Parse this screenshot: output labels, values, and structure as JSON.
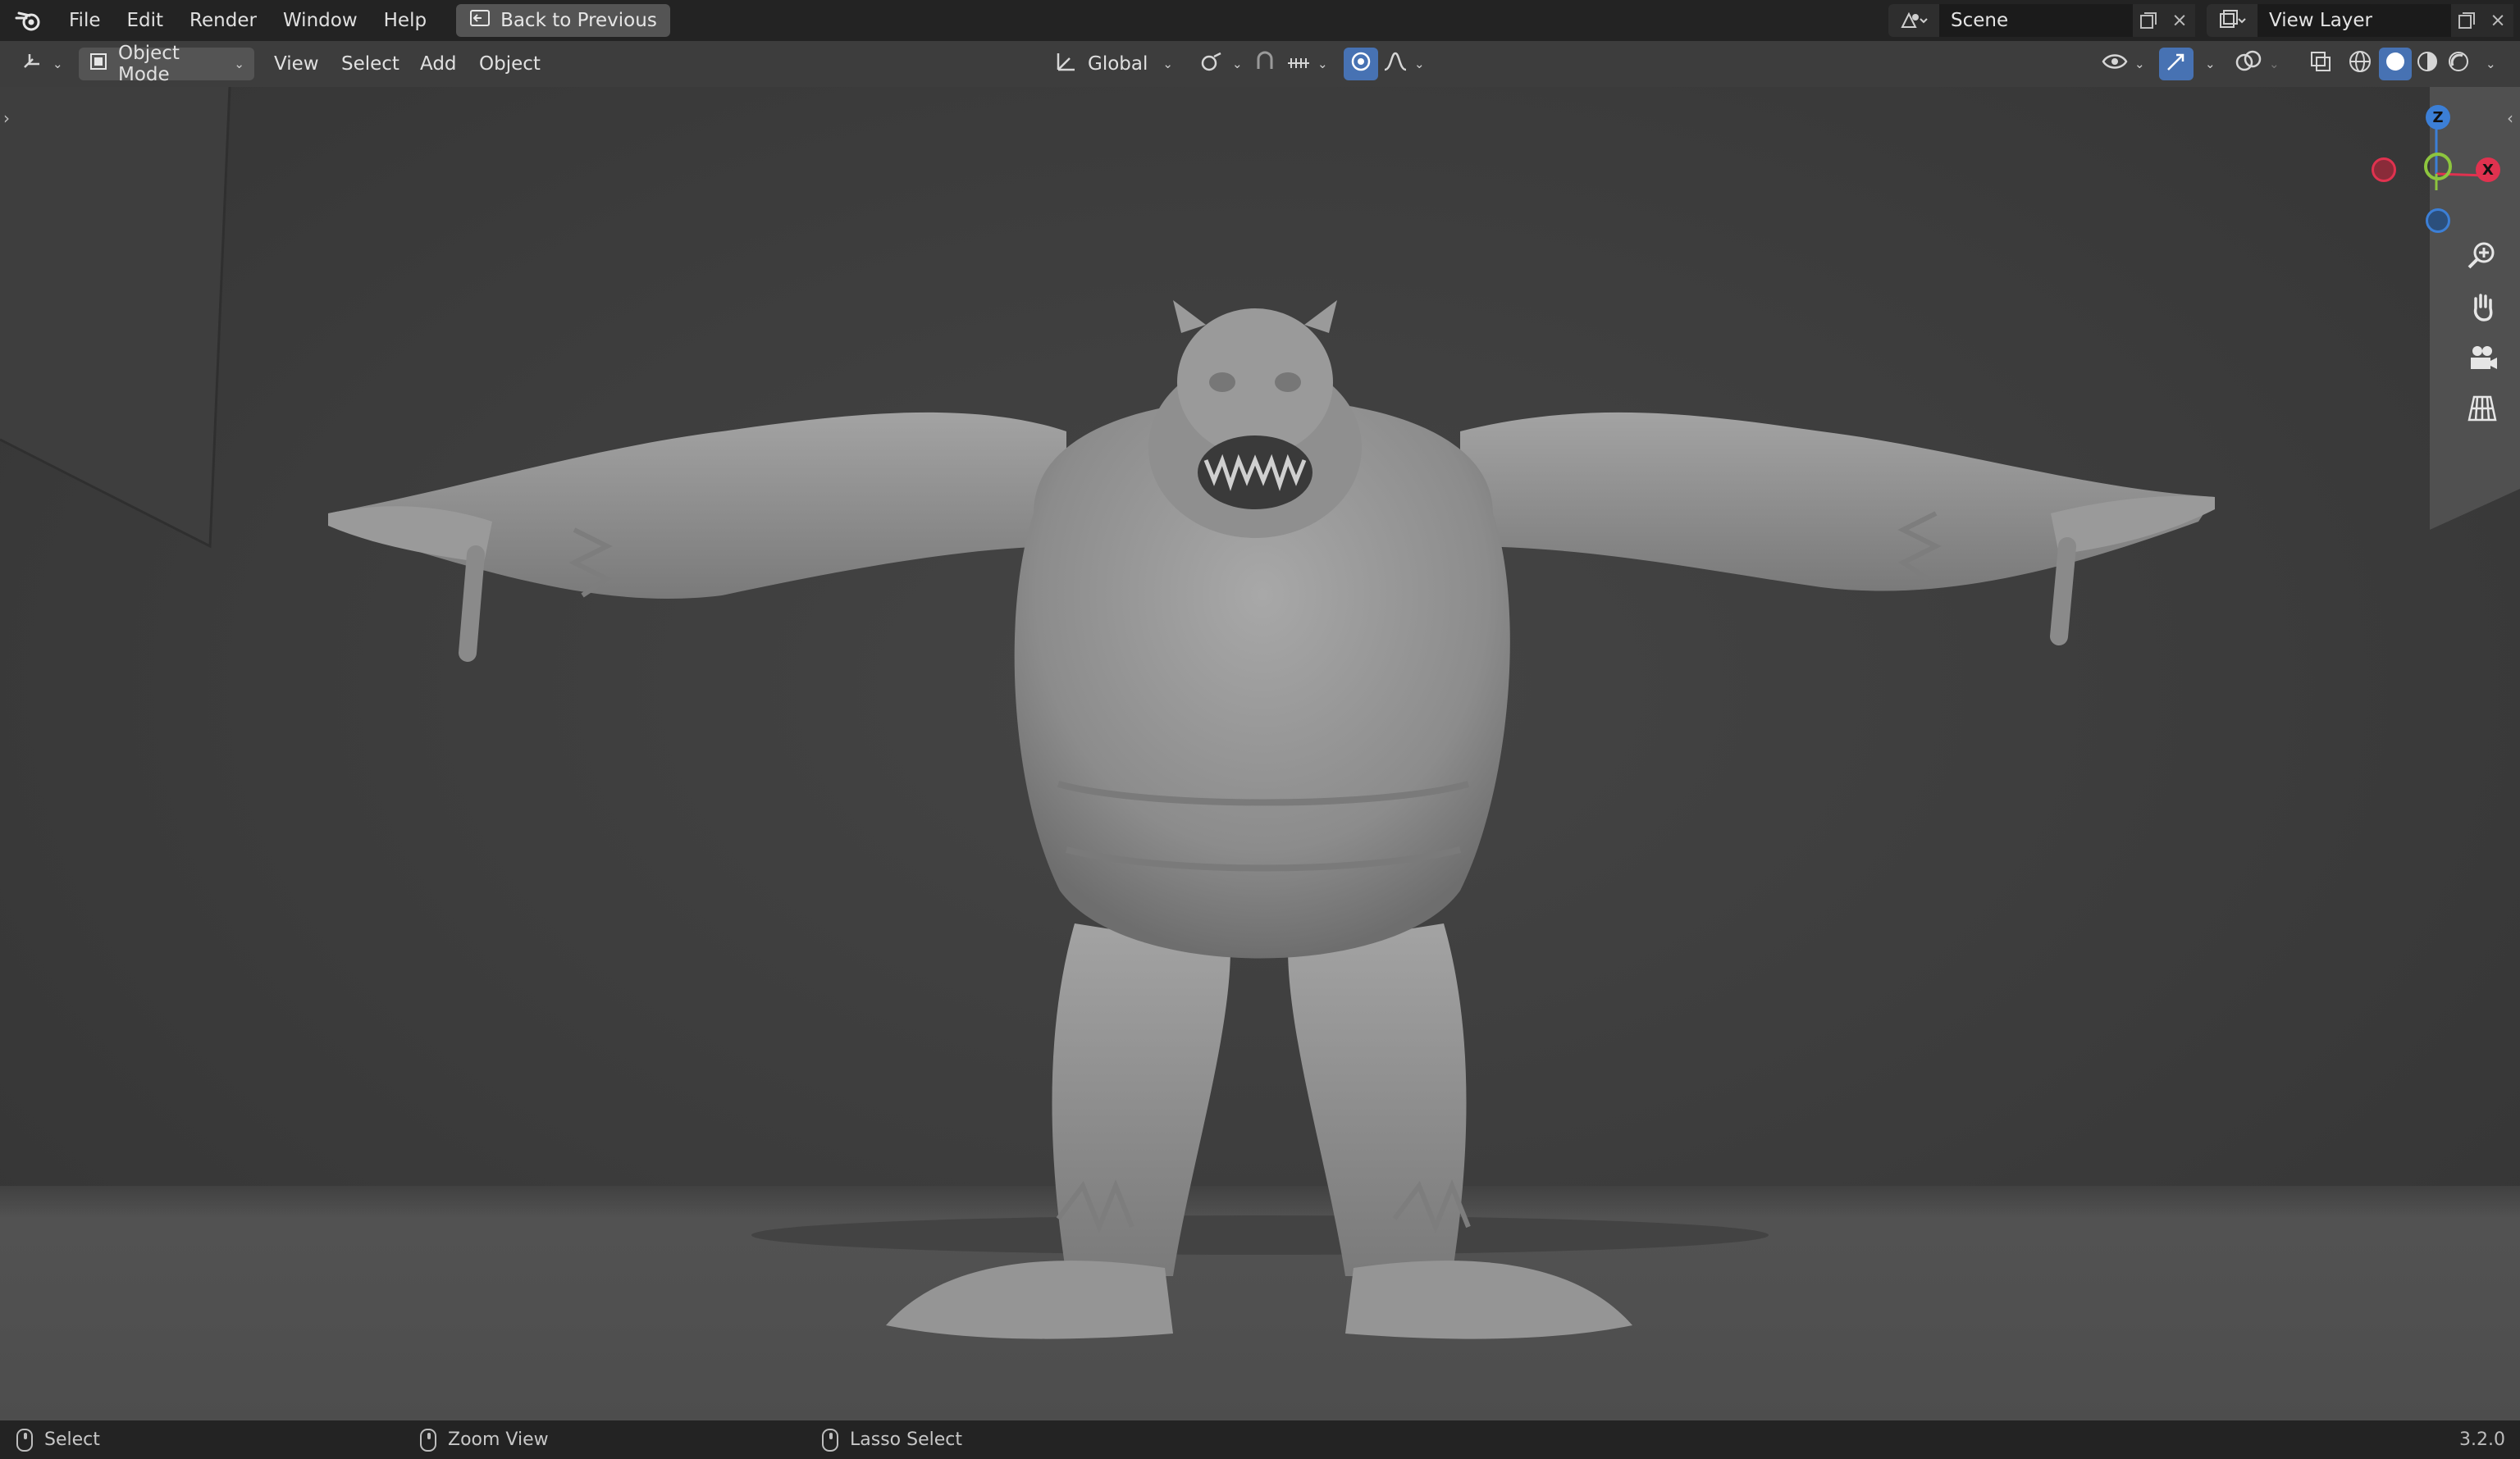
{
  "menu": {
    "items": [
      "File",
      "Edit",
      "Render",
      "Window",
      "Help"
    ],
    "back_button": "Back to Previous"
  },
  "scene": {
    "name": "Scene",
    "view_layer": "View Layer"
  },
  "viewport_header": {
    "mode": "Object Mode",
    "menus": [
      "View",
      "Select",
      "Add",
      "Object"
    ],
    "transform_orientation": "Global"
  },
  "gizmo": {
    "z": "Z",
    "x": "X"
  },
  "statusbar": {
    "left": "Select",
    "middle": "Zoom View",
    "right": "Lasso Select",
    "version": "3.2.0"
  },
  "colors": {
    "accent": "#4772b3",
    "x_axis": "#e0324f",
    "y_axis": "#8dc53e",
    "z_axis": "#3c7fd6"
  },
  "icons": [
    "blender-logo-icon",
    "back-icon",
    "scene-icon",
    "view-layer-icon",
    "new-icon",
    "close-icon",
    "editor-type-icon",
    "object-mode-icon",
    "orientation-icon",
    "pivot-icon",
    "snap-icon",
    "snap-target-icon",
    "proportional-icon",
    "falloff-icon",
    "visibility-icon",
    "gizmo-icon",
    "overlay-icon",
    "xray-icon",
    "wireframe-shading-icon",
    "solid-shading-icon",
    "material-shading-icon",
    "rendered-shading-icon",
    "zoom-icon",
    "pan-hand-icon",
    "camera-icon",
    "grid-view-icon"
  ]
}
